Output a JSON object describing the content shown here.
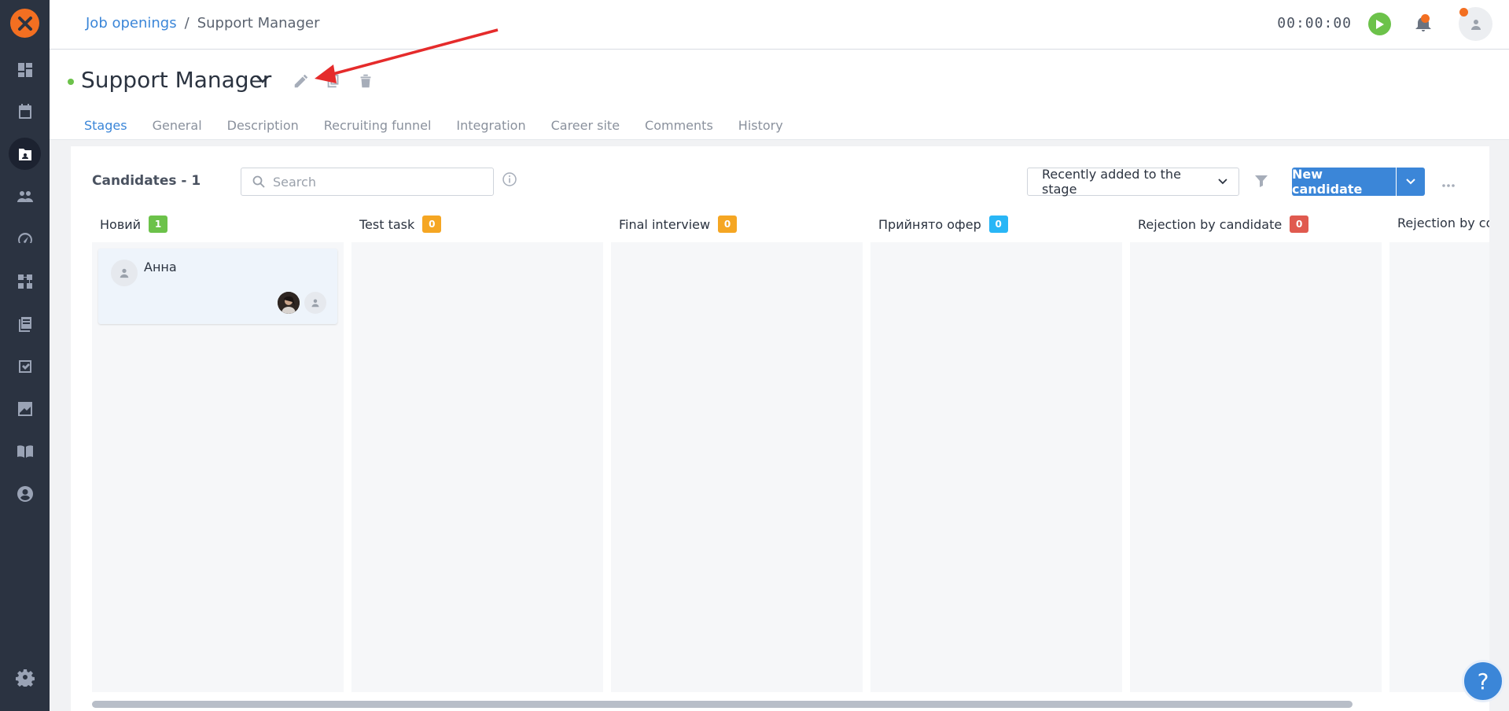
{
  "breadcrumb": {
    "parent": "Job openings",
    "separator": "/",
    "current": "Support Manager"
  },
  "timer": "00:00:00",
  "job": {
    "title": "Support Manager"
  },
  "tabs": [
    {
      "label": "Stages"
    },
    {
      "label": "General"
    },
    {
      "label": "Description"
    },
    {
      "label": "Recruiting funnel"
    },
    {
      "label": "Integration"
    },
    {
      "label": "Career site"
    },
    {
      "label": "Comments"
    },
    {
      "label": "History"
    }
  ],
  "toolbar": {
    "candidates_count": "Candidates - 1",
    "search_placeholder": "Search",
    "sort_value": "Recently added to the stage",
    "new_candidate": "New candidate"
  },
  "stages": [
    {
      "name": "Новий",
      "count": "1",
      "color": "#6cc24a"
    },
    {
      "name": "Test task",
      "count": "0",
      "color": "#f5a623"
    },
    {
      "name": "Final interview",
      "count": "0",
      "color": "#f5a623"
    },
    {
      "name": "Прийнято офер",
      "count": "0",
      "color": "#29b6f6"
    },
    {
      "name": "Rejection by candidate",
      "count": "0",
      "color": "#e05a4f"
    },
    {
      "name": "Rejection by com",
      "count": "",
      "color": ""
    }
  ],
  "candidate": {
    "name": "Анна"
  },
  "help_label": "?",
  "colors": {
    "accent": "#3b86d8",
    "sidebar": "#2b3341",
    "brand": "#f36f21"
  }
}
